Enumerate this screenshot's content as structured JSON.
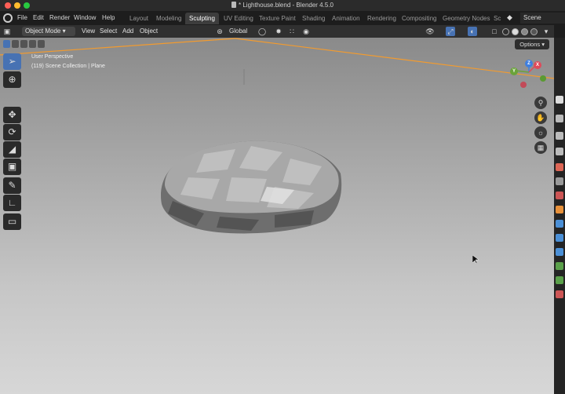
{
  "window": {
    "title": "* Lighthouse.blend - Blender 4.5.0"
  },
  "menu": {
    "items": [
      "File",
      "Edit",
      "Render",
      "Window",
      "Help"
    ]
  },
  "workspaces": {
    "tabs": [
      "Layout",
      "Modeling",
      "Sculpting",
      "UV Editing",
      "Texture Paint",
      "Shading",
      "Animation",
      "Rendering",
      "Compositing",
      "Geometry Nodes",
      "Sc"
    ],
    "active": "Sculpting"
  },
  "scene": {
    "label": "Scene"
  },
  "viewport_header": {
    "mode": "Object Mode",
    "menus": [
      "View",
      "Select",
      "Add",
      "Object"
    ],
    "orientation": "Global"
  },
  "viewport": {
    "perspective": "User Perspective",
    "collection_info": "(119) Scene Collection | Plane",
    "options_label": "Options"
  },
  "gizmo": {
    "axis_labels": {
      "x": "X",
      "y": "Y",
      "z": "Z"
    }
  },
  "colors": {
    "accent_blue": "#4772b3",
    "active_outline": "#f29b2f",
    "x_axis": "#e04a5a",
    "y_axis": "#6aa33a",
    "z_axis": "#3f7fe0"
  }
}
